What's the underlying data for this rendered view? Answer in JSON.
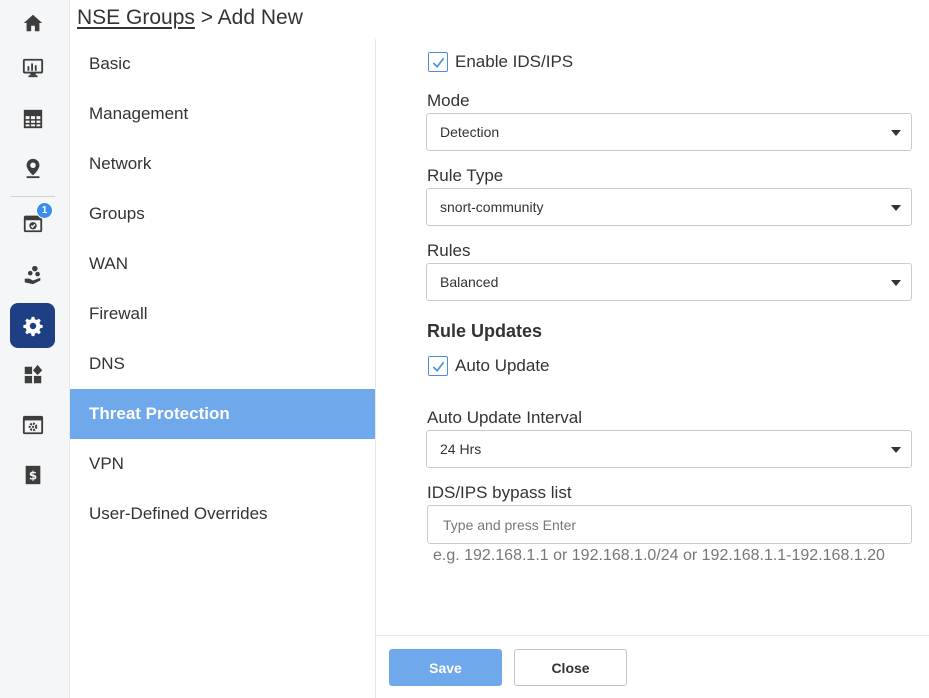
{
  "breadcrumb": {
    "parent": "NSE Groups",
    "separator": " > ",
    "current": "Add New"
  },
  "rail": {
    "items": [
      {
        "icon": "home-icon"
      },
      {
        "icon": "monitor-chart-icon"
      },
      {
        "icon": "table-icon"
      },
      {
        "icon": "map-pin-icon"
      },
      {
        "icon": "calendar-check-icon",
        "badge": "1"
      },
      {
        "icon": "users-hand-icon"
      },
      {
        "icon": "gear-icon",
        "active": true
      },
      {
        "icon": "widgets-icon"
      },
      {
        "icon": "window-gear-icon"
      },
      {
        "icon": "billing-icon"
      }
    ],
    "active_color": "#1f3f85"
  },
  "sidenav": {
    "items": [
      {
        "label": "Basic"
      },
      {
        "label": "Management"
      },
      {
        "label": "Network"
      },
      {
        "label": "Groups"
      },
      {
        "label": "WAN"
      },
      {
        "label": "Firewall"
      },
      {
        "label": "DNS"
      },
      {
        "label": "Threat Protection",
        "active": true
      },
      {
        "label": "VPN"
      },
      {
        "label": "User-Defined Overrides"
      }
    ],
    "active_color": "#6fa9ec"
  },
  "form": {
    "enable_ids": {
      "label": "Enable IDS/IPS",
      "checked": true
    },
    "mode": {
      "label": "Mode",
      "value": "Detection"
    },
    "rule_type": {
      "label": "Rule Type",
      "value": "snort-community"
    },
    "rules": {
      "label": "Rules",
      "value": "Balanced"
    },
    "rule_updates": {
      "heading": "Rule Updates"
    },
    "auto_update": {
      "label": "Auto Update",
      "checked": true
    },
    "auto_update_interval": {
      "label": "Auto Update Interval",
      "value": "24 Hrs"
    },
    "bypass": {
      "label": "IDS/IPS bypass list",
      "placeholder": "Type and press Enter",
      "value": "",
      "hint": "e.g. 192.168.1.1 or 192.168.1.0/24 or 192.168.1.1-192.168.1.20"
    }
  },
  "footer": {
    "save_label": "Save",
    "close_label": "Close",
    "save_color": "#6fa9ec"
  }
}
